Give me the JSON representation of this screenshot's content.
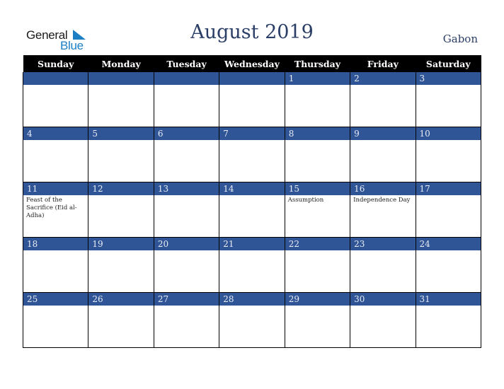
{
  "logo": {
    "line1": "General",
    "line2": "Blue"
  },
  "title": "August 2019",
  "country": "Gabon",
  "colors": {
    "band": "#2f5597",
    "header_bg": "#000000",
    "title": "#2b3e66",
    "logo_blue": "#1c7fc4"
  },
  "weekdays": [
    "Sunday",
    "Monday",
    "Tuesday",
    "Wednesday",
    "Thursday",
    "Friday",
    "Saturday"
  ],
  "weeks": [
    {
      "days": [
        "",
        "",
        "",
        "",
        "1",
        "2",
        "3"
      ],
      "events": [
        "",
        "",
        "",
        "",
        "",
        "",
        ""
      ]
    },
    {
      "days": [
        "4",
        "5",
        "6",
        "7",
        "8",
        "9",
        "10"
      ],
      "events": [
        "",
        "",
        "",
        "",
        "",
        "",
        ""
      ]
    },
    {
      "days": [
        "11",
        "12",
        "13",
        "14",
        "15",
        "16",
        "17"
      ],
      "events": [
        "Feast of the Sacrifice (Eid al-Adha)",
        "",
        "",
        "",
        "Assumption",
        "Independence Day",
        ""
      ]
    },
    {
      "days": [
        "18",
        "19",
        "20",
        "21",
        "22",
        "23",
        "24"
      ],
      "events": [
        "",
        "",
        "",
        "",
        "",
        "",
        ""
      ]
    },
    {
      "days": [
        "25",
        "26",
        "27",
        "28",
        "29",
        "30",
        "31"
      ],
      "events": [
        "",
        "",
        "",
        "",
        "",
        "",
        ""
      ]
    }
  ]
}
